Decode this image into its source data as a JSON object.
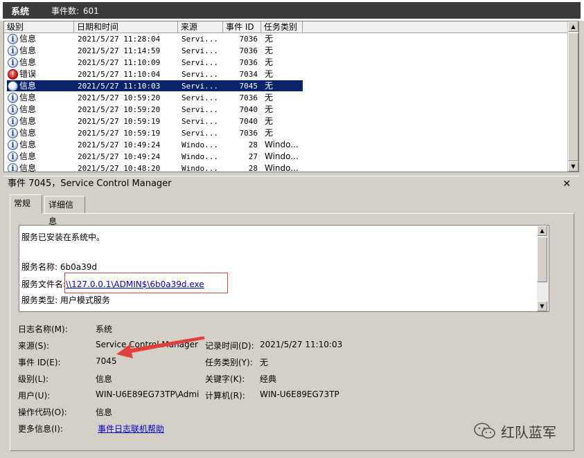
{
  "window": {
    "title": "系统",
    "count_label": "事件数:",
    "count_value": "601"
  },
  "list": {
    "columns": [
      "级别",
      "日期和时间",
      "来源",
      "事件 ID",
      "任务类别"
    ],
    "rows": [
      {
        "level": "信息",
        "icon": "info-icon",
        "datetime": "2021/5/27 11:28:04",
        "source": "Servi...",
        "id": "7036",
        "task": "无"
      },
      {
        "level": "信息",
        "icon": "info-icon",
        "datetime": "2021/5/27 11:14:59",
        "source": "Servi...",
        "id": "7036",
        "task": "无"
      },
      {
        "level": "信息",
        "icon": "info-icon",
        "datetime": "2021/5/27 11:10:09",
        "source": "Servi...",
        "id": "7036",
        "task": "无"
      },
      {
        "level": "错误",
        "icon": "error-icon",
        "datetime": "2021/5/27 11:10:04",
        "source": "Servi...",
        "id": "7034",
        "task": "无"
      },
      {
        "level": "信息",
        "icon": "info-icon",
        "datetime": "2021/5/27 11:10:03",
        "source": "Servi...",
        "id": "7045",
        "task": "无",
        "selected": true
      },
      {
        "level": "信息",
        "icon": "info-icon",
        "datetime": "2021/5/27 10:59:20",
        "source": "Servi...",
        "id": "7036",
        "task": "无"
      },
      {
        "level": "信息",
        "icon": "info-icon",
        "datetime": "2021/5/27 10:59:20",
        "source": "Servi...",
        "id": "7040",
        "task": "无"
      },
      {
        "level": "信息",
        "icon": "info-icon",
        "datetime": "2021/5/27 10:59:19",
        "source": "Servi...",
        "id": "7040",
        "task": "无"
      },
      {
        "level": "信息",
        "icon": "info-icon",
        "datetime": "2021/5/27 10:59:19",
        "source": "Servi...",
        "id": "7036",
        "task": "无"
      },
      {
        "level": "信息",
        "icon": "info-icon",
        "datetime": "2021/5/27 10:49:24",
        "source": "Windo...",
        "id": "28",
        "task": "Windo..."
      },
      {
        "level": "信息",
        "icon": "info-icon",
        "datetime": "2021/5/27 10:49:24",
        "source": "Windo...",
        "id": "27",
        "task": "Windo..."
      },
      {
        "level": "信息",
        "icon": "info-icon",
        "datetime": "2021/5/27 10:48:20",
        "source": "Windo...",
        "id": "28",
        "task": "Windo..."
      }
    ]
  },
  "detail": {
    "title": "事件 7045，Service Control Manager",
    "tabs": [
      "常规",
      "详细信息"
    ],
    "description": {
      "line1": "服务已安装在系统中。",
      "name_label": "服务名称:",
      "name_value": "6b0a39d",
      "file_label": "服务文件名:",
      "file_value": "\\\\127.0.0.1\\ADMIN$\\6b0a39d.exe",
      "type_label": "服务类型:",
      "type_value": "用户模式服务"
    },
    "props": {
      "log_name_label": "日志名称(M):",
      "log_name": "系统",
      "source_label": "来源(S):",
      "source": "Service Control Manager",
      "logged_label": "记录时间(D):",
      "logged": "2021/5/27 11:10:03",
      "event_id_label": "事件 ID(E):",
      "event_id": "7045",
      "task_label": "任务类别(Y):",
      "task": "无",
      "level_label": "级别(L):",
      "level": "信息",
      "keywords_label": "关键字(K):",
      "keywords": "经典",
      "user_label": "用户(U):",
      "user": "WIN-U6E89EG73TP\\Admi",
      "computer_label": "计算机(R):",
      "computer": "WIN-U6E89EG73TP",
      "opcode_label": "操作代码(O):",
      "opcode": "信息",
      "more_label": "更多信息(I):",
      "more_link": "事件日志联机帮助"
    }
  },
  "watermark": {
    "text": "红队蓝军"
  },
  "colors": {
    "title_bg": "#3a3a3a",
    "selection": "#0a246a",
    "link": "#0000c0",
    "highlight": "#e0403a"
  }
}
